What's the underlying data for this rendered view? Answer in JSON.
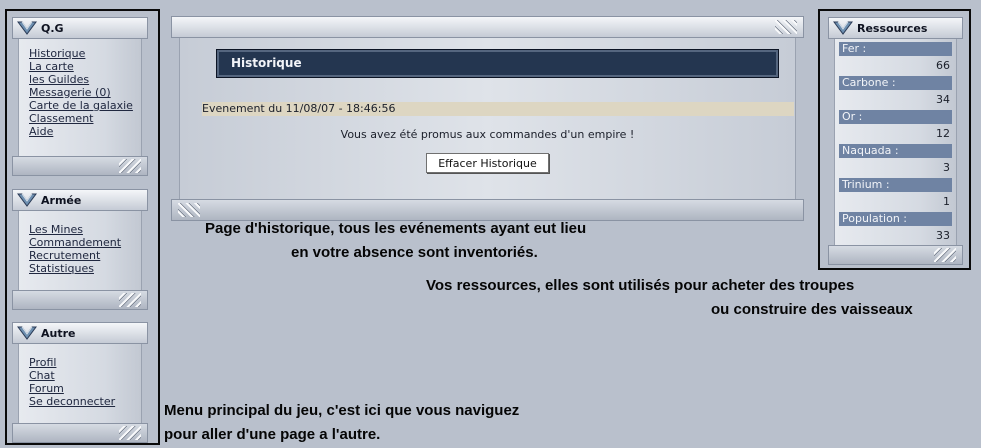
{
  "menus": {
    "qg": {
      "title": "Q.G",
      "items": [
        "Historique",
        "La carte",
        "les Guildes",
        "Messagerie (0)",
        "Carte de la galaxie",
        "Classement",
        "Aide"
      ]
    },
    "armee": {
      "title": "Armée",
      "items": [
        "Les Mines",
        "Commandement",
        "Recrutement",
        "Statistiques"
      ]
    },
    "autre": {
      "title": "Autre",
      "items": [
        "Profil",
        "Chat",
        "Forum",
        "Se deconnecter"
      ]
    }
  },
  "main": {
    "title": "Historique",
    "event_label": "Evenement du 11/08/07 - 18:46:56",
    "event_message": "Vous avez été promus aux commandes d'un empire !",
    "clear_button": "Effacer Historique"
  },
  "resources": {
    "title": "Ressources",
    "items": [
      {
        "name": "Fer :",
        "value": "66"
      },
      {
        "name": "Carbone :",
        "value": "34"
      },
      {
        "name": "Or :",
        "value": "12"
      },
      {
        "name": "Naquada :",
        "value": "3"
      },
      {
        "name": "Trinium :",
        "value": "1"
      },
      {
        "name": "Population :",
        "value": "33"
      }
    ]
  },
  "annotations": {
    "history_line1": "Page d'historique, tous les evénements ayant eut lieu",
    "history_line2": "en votre absence sont inventoriés.",
    "resources_line1": "Vos ressources, elles sont utilisés pour acheter des troupes",
    "resources_line2": "ou construire des vaisseaux",
    "menu_line1": "Menu principal du jeu, c'est ici que vous naviguez",
    "menu_line2": "pour aller d'une page a l'autre."
  },
  "colors": {
    "background": "#b9c0cc",
    "title_bar": "#243650",
    "resource_label": "#6f83a3",
    "event_row": "#ddd6c2"
  }
}
